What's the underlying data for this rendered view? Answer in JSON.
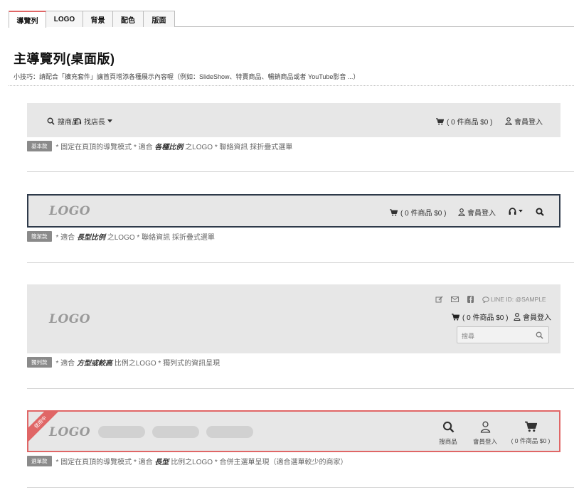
{
  "tabs": [
    {
      "label": "導覽列",
      "active": true
    },
    {
      "label": "LOGO",
      "active": false
    },
    {
      "label": "背景",
      "active": false
    },
    {
      "label": "配色",
      "active": false
    },
    {
      "label": "版面",
      "active": false
    }
  ],
  "header": {
    "title": "主導覽列(桌面版)",
    "tip": "小技巧：請配合「擴充套件」讓首頁增添各種展示內容喔（例如：SlideShow、特賣商品、暢銷商品或者 YouTube影音 ...）"
  },
  "options": [
    {
      "nav": {
        "search": "搜商品",
        "contact": "找店長",
        "cart": "( 0 件商品 $0 )",
        "login": "會員登入"
      },
      "badge": "基本款",
      "desc": {
        "t1": "* 固定在頁頂的導覽模式 * 適合",
        "em": "各種比例",
        "t2": "之LOGO * 聯絡資訊 採折疊式選單"
      }
    },
    {
      "logo": "LOGO",
      "nav": {
        "cart": "( 0 件商品 $0 )",
        "login": "會員登入"
      },
      "badge": "簡潔款",
      "desc": {
        "t1": "* 適合",
        "em": "長型比例",
        "t2": "之LOGO * 聯絡資訊 採折疊式選單"
      }
    },
    {
      "logo": "LOGO",
      "line_id": "LINE ID: @SAMPLE",
      "nav": {
        "cart": "( 0 件商品 $0 )",
        "login": "會員登入"
      },
      "search_placeholder": "搜尋",
      "badge": "獨列款",
      "desc": {
        "t1": "* 適合",
        "em": "方型或較高",
        "t2": "比例之LOGO * 獨列式的資訊呈現"
      }
    },
    {
      "logo": "LOGO",
      "ribbon": "使用中",
      "nav": {
        "search": "搜商品",
        "login": "會員登入",
        "cart": "( 0 件商品 $0 )"
      },
      "badge": "選單款",
      "desc": {
        "t1": "* 固定在頁頂的導覽模式 * 適合",
        "em": "長型",
        "t2": "比例之LOGO * 合併主選單呈現（適合選單較少的商家）"
      }
    }
  ],
  "colors": {
    "active_border": "#e06666",
    "selected_frame": "#2e3a4a",
    "banner_bg": "#e7e7e7",
    "badge_bg": "#8a8a8a"
  }
}
